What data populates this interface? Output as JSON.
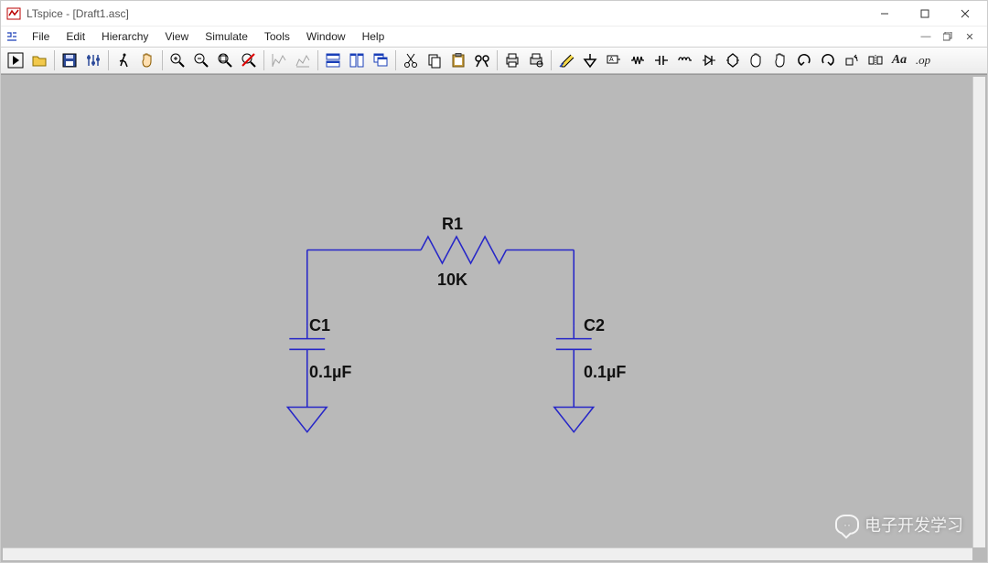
{
  "window": {
    "title": "LTspice - [Draft1.asc]"
  },
  "menu": {
    "items": [
      "File",
      "Edit",
      "Hierarchy",
      "View",
      "Simulate",
      "Tools",
      "Window",
      "Help"
    ]
  },
  "toolbar": {
    "icons": [
      "run",
      "open",
      "sep",
      "save",
      "netlist",
      "sep",
      "run-man",
      "pan",
      "sep",
      "zoom-in",
      "zoom-out",
      "zoom-fit",
      "zoom-off",
      "sep",
      "autorange",
      "grid",
      "sep",
      "tile-h",
      "tile-v",
      "cascade",
      "sep",
      "cut",
      "copy",
      "paste",
      "find",
      "sep",
      "print",
      "setup",
      "sep",
      "wire",
      "ground",
      "label",
      "resistor",
      "capacitor",
      "inductor",
      "diode",
      "component",
      "move",
      "drag",
      "undo",
      "redo",
      "rotate",
      "mirror",
      "text",
      "op"
    ],
    "text_aa": "Aa",
    "text_op": ".op"
  },
  "schematic": {
    "r1": {
      "name": "R1",
      "value": "10K"
    },
    "c1": {
      "name": "C1",
      "value": "0.1µF"
    },
    "c2": {
      "name": "C2",
      "value": "0.1µF"
    }
  },
  "watermark": {
    "text": "电子开发学习"
  }
}
